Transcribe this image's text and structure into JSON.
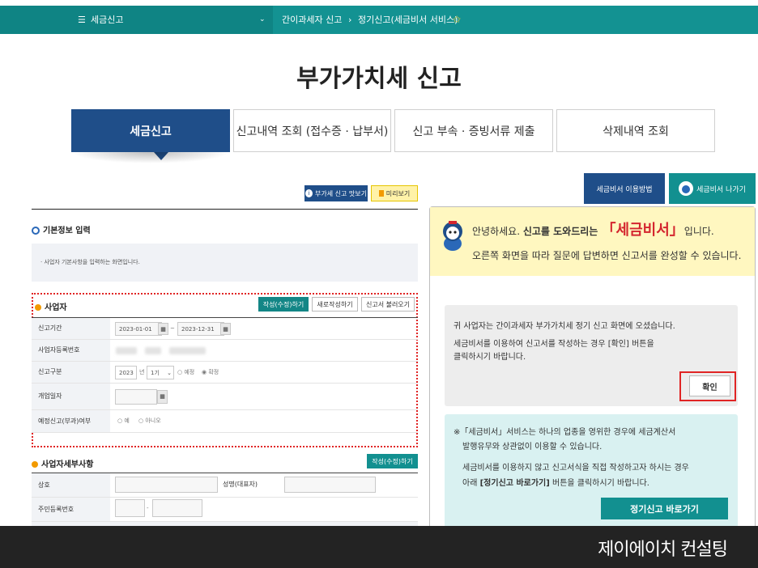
{
  "nav": {
    "menu_label": "세금신고",
    "breadcrumb_1": "간이과세자 신고",
    "breadcrumb_2": "정기신고(세금비서 서비스)"
  },
  "page_title": "부가가치세 신고",
  "tabs": [
    {
      "label": "세금신고",
      "active": true
    },
    {
      "label": "신고내역 조회 (접수증 · 납부서)"
    },
    {
      "label": "신고 부속 · 증빙서류 제출"
    },
    {
      "label": "삭제내역 조회"
    }
  ],
  "left": {
    "vat_guide_btn": "부가세 신고 맛보기",
    "preview_btn": "미리보기",
    "basic_info_title": "기본정보 입력",
    "basic_info_desc": "· 사업자 기본사항을 입력하는 화면입니다.",
    "business_title": "사업자",
    "btn_edit": "작성(수정)하기",
    "btn_new": "새로작성하기",
    "btn_load": "신고서 불러오기",
    "rows": {
      "period_label": "신고기간",
      "period_start": "2023-01-01",
      "period_sep": "~",
      "period_end": "2023-12-31",
      "biz_no_label": "사업자등록번호",
      "type_label": "신고구분",
      "type_year": "2023",
      "type_year_unit": "년",
      "type_term": "1기",
      "type_opt1": "예정",
      "type_opt2": "확정",
      "open_date_label": "개업일자",
      "prelim_label": "예정신고(부과)여부",
      "prelim_yes": "예",
      "prelim_no": "아니오"
    },
    "detail_title": "사업자세부사항",
    "detail_btn": "작성(수정)하기",
    "detail_rows": {
      "trade_name_label": "상호",
      "owner_label": "성명(대표자)",
      "resident_no_label": "주민등록번호",
      "resident_sep": "-"
    }
  },
  "right": {
    "guide_btn": "세금비서 이용방법",
    "exit_btn": "세금비서 나가기",
    "greet_1a": "안녕하세요. ",
    "greet_1b": "신고를 도와드리는 ",
    "greet_1c": "「세금비서」",
    "greet_1d": "입니다.",
    "greet_2": "오른쪽 화면을 따라 질문에 답변하면 신고서를 완성할 수 있습니다.",
    "msg1_line1": "귀 사업자는 간이과세자 부가가치세 정기 신고 화면에 오셨습니다.",
    "msg1_line2": "세금비서를 이용하여 신고서를 작성하는 경우 [확인] 버튼을",
    "msg1_line3": "클릭하시기 바랍니다.",
    "confirm_btn": "확인",
    "msg2_line1": "※「세금비서」서비스는 하나의 업종을 영위한 경우에 세금계산서",
    "msg2_line2": "발행유무와 상관없이 이용할 수 있습니다.",
    "msg2_line3": "세금비서를 이용하지 않고 신고서식을 직접 작성하고자 하시는 경우",
    "msg2_line4a": "아래 ",
    "msg2_line4b": "[정기신고 바로가기]",
    "msg2_line4c": " 버튼을 클릭하시기 바랍니다.",
    "shortcut_btn": "정기신고 바로가기"
  },
  "footer_brand": "제이에이치 컨설팅"
}
